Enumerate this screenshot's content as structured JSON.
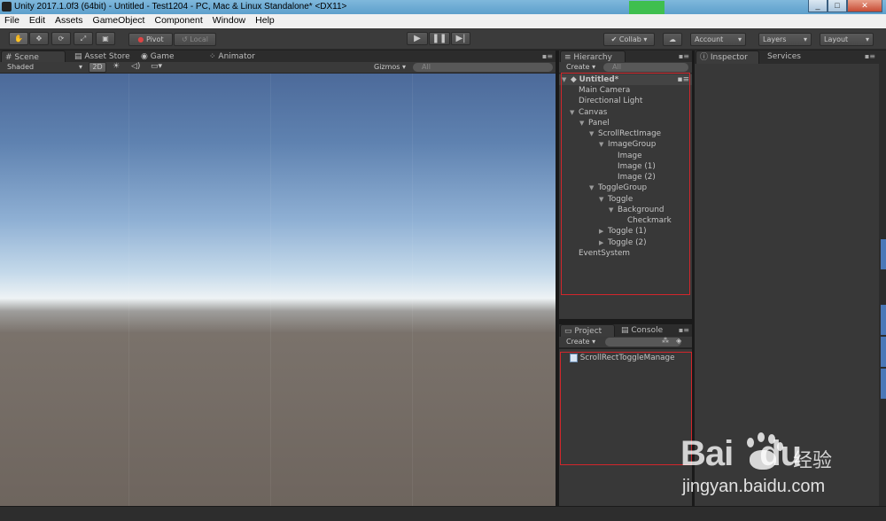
{
  "window": {
    "title": "Unity 2017.1.0f3 (64bit) - Untitled - Test1204 - PC, Mac & Linux Standalone* <DX11>",
    "controls": [
      "_",
      "□",
      "✕"
    ]
  },
  "menu": [
    "File",
    "Edit",
    "Assets",
    "GameObject",
    "Component",
    "Window",
    "Help"
  ],
  "toolbar": {
    "transform_tools": [
      "hand-icon",
      "move-icon",
      "rotate-icon",
      "scale-icon",
      "rect-tool-icon"
    ],
    "pivot_label": "Pivot",
    "local_label": "Local",
    "collab_label": "Collab",
    "account_label": "Account",
    "layers_label": "Layers",
    "layout_label": "Layout"
  },
  "scene_panel": {
    "tabs": [
      "Scene",
      "Asset Store",
      "Game",
      "Animator"
    ],
    "shading": "Shaded",
    "mode_2d": "2D",
    "gizmos": "Gizmos",
    "search_placeholder": "All"
  },
  "hierarchy": {
    "tab_label": "Hierarchy",
    "create_label": "Create",
    "search_placeholder": "All",
    "scene_name": "Untitled*",
    "items": [
      {
        "label": "Main Camera",
        "depth": 0,
        "arrow": ""
      },
      {
        "label": "Directional Light",
        "depth": 0,
        "arrow": ""
      },
      {
        "label": "Canvas",
        "depth": 0,
        "arrow": "▼"
      },
      {
        "label": "Panel",
        "depth": 1,
        "arrow": "▼"
      },
      {
        "label": "ScrollRectImage",
        "depth": 2,
        "arrow": "▼"
      },
      {
        "label": "ImageGroup",
        "depth": 3,
        "arrow": "▼"
      },
      {
        "label": "Image",
        "depth": 4,
        "arrow": ""
      },
      {
        "label": "Image (1)",
        "depth": 4,
        "arrow": ""
      },
      {
        "label": "Image (2)",
        "depth": 4,
        "arrow": ""
      },
      {
        "label": "ToggleGroup",
        "depth": 2,
        "arrow": "▼"
      },
      {
        "label": "Toggle",
        "depth": 3,
        "arrow": "▼"
      },
      {
        "label": "Background",
        "depth": 4,
        "arrow": "▼"
      },
      {
        "label": "Checkmark",
        "depth": 5,
        "arrow": ""
      },
      {
        "label": "Toggle (1)",
        "depth": 3,
        "arrow": "▶"
      },
      {
        "label": "Toggle (2)",
        "depth": 3,
        "arrow": "▶"
      },
      {
        "label": "EventSystem",
        "depth": 0,
        "arrow": ""
      }
    ]
  },
  "project": {
    "tabs": [
      "Project",
      "Console"
    ],
    "create_label": "Create",
    "file": "ScrollRectToggleManage"
  },
  "inspector": {
    "tabs": [
      "Inspector",
      "Services"
    ]
  },
  "watermark": {
    "brand": "Bai",
    "brand2": "du",
    "cn": "经验",
    "url": "jingyan.baidu.com"
  },
  "colors": {
    "highlight_border": "#d2262b",
    "editor_bg": "#383838"
  }
}
